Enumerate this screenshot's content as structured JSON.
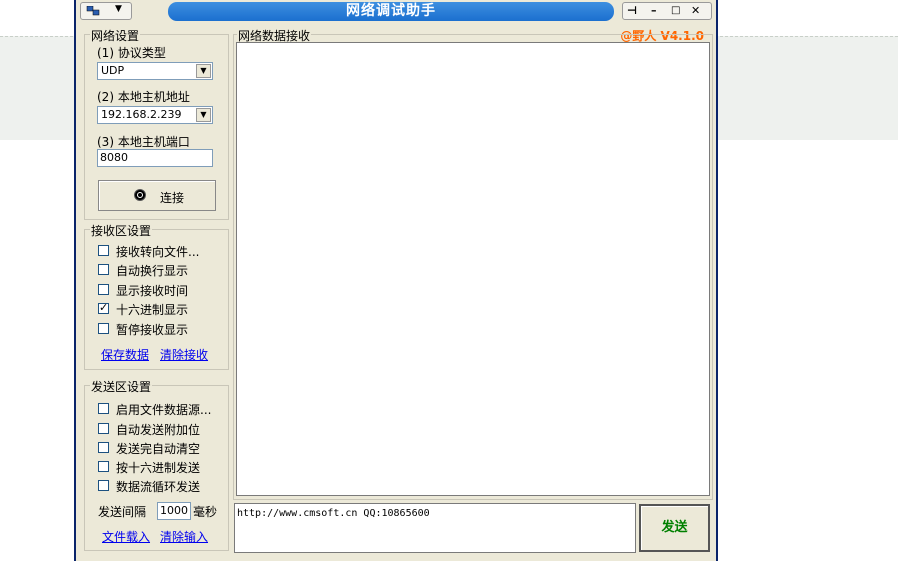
{
  "window": {
    "title": "网络调试助手",
    "version": "@野人 V4.1.0"
  },
  "network": {
    "group_title": "网络设置",
    "protocol_label": "(1) 协议类型",
    "protocol_value": "UDP",
    "host_label": "(2) 本地主机地址",
    "host_value": "192.168.2.239",
    "port_label": "(3) 本地主机端口",
    "port_value": "8080",
    "connect_label": "连接"
  },
  "receive_settings": {
    "group_title": "接收区设置",
    "options": [
      {
        "label": "接收转向文件...",
        "checked": false
      },
      {
        "label": "自动换行显示",
        "checked": false
      },
      {
        "label": "显示接收时间",
        "checked": false
      },
      {
        "label": "十六进制显示",
        "checked": true
      },
      {
        "label": "暂停接收显示",
        "checked": false
      }
    ],
    "save_link": "保存数据",
    "clear_link": "清除接收"
  },
  "send_settings": {
    "group_title": "发送区设置",
    "options": [
      {
        "label": "启用文件数据源...",
        "checked": false
      },
      {
        "label": "自动发送附加位",
        "checked": false
      },
      {
        "label": "发送完自动清空",
        "checked": false
      },
      {
        "label": "按十六进制发送",
        "checked": false
      },
      {
        "label": "数据流循环发送",
        "checked": false
      }
    ],
    "interval_label": "发送间隔",
    "interval_value": "1000",
    "interval_unit": "毫秒",
    "load_link": "文件载入",
    "clear_link": "清除输入"
  },
  "receive_area": {
    "title": "网络数据接收",
    "content": ""
  },
  "send_area": {
    "content": "http://www.cmsoft.cn QQ:10865600",
    "send_button": "发送"
  }
}
